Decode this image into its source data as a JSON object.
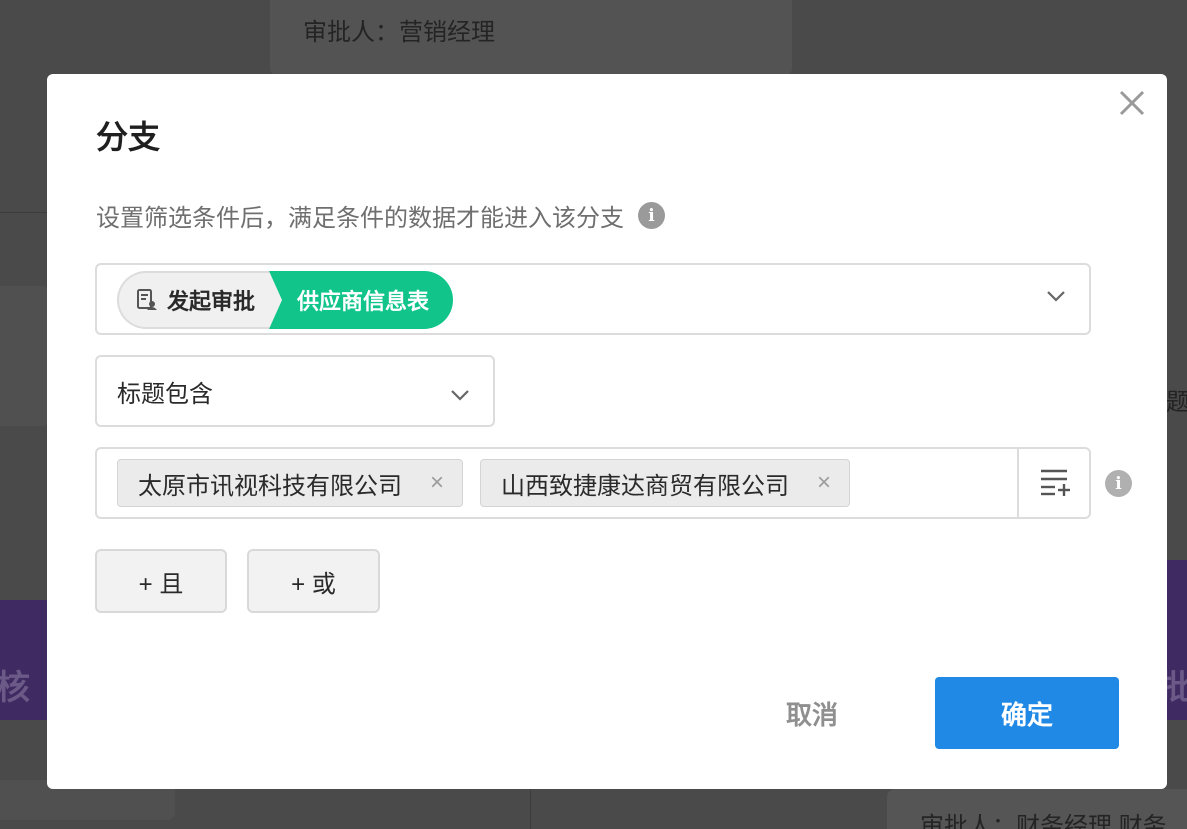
{
  "background": {
    "top_card_text": "审批人：营销经理",
    "right_partial_text": "题",
    "bottom_text": "审批人：财务经理   财务",
    "purple_glyph_left": "核",
    "purple_glyph_right": "批"
  },
  "dialog": {
    "title": "分支",
    "description": "设置筛选条件后，满足条件的数据才能进入该分支",
    "close_icon": "close-icon",
    "source": {
      "step": "发起审批",
      "form": "供应商信息表",
      "step_color": "#f0f0f0",
      "form_color": "#11c48a"
    },
    "condition": {
      "field": "标题包含",
      "values": [
        "太原市讯视科技有限公司",
        "山西致捷康达商贸有限公司"
      ],
      "remove_symbol": "×"
    },
    "logic_buttons": {
      "and_label": "+ 且",
      "or_label": "+ 或"
    },
    "footer": {
      "cancel_label": "取消",
      "confirm_label": "确定",
      "confirm_color": "#2089e6"
    },
    "info_glyph": "i"
  }
}
